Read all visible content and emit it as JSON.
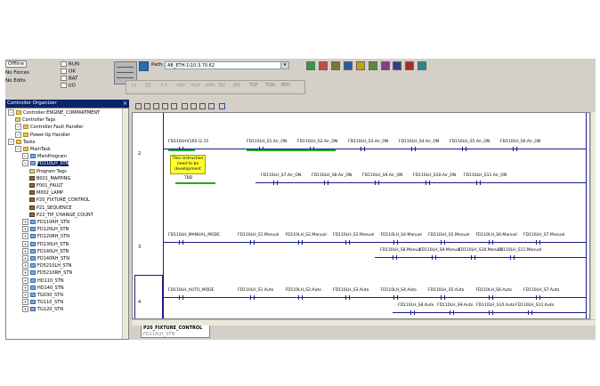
{
  "status": {
    "mode": "Offline",
    "forces": "No Forces",
    "edits": "No Edits",
    "flags": [
      "RUN",
      "OK",
      "BAT",
      "I/O"
    ]
  },
  "path": {
    "label": "Path:",
    "value": "AB_ETH-1\\10.3.70.62"
  },
  "instruction_toolbar": [
    "|-|",
    "|/|",
    "-( )-",
    "<|>",
    "<L>",
    "<U>",
    "(L)",
    "(U)",
    "TOF",
    "TON",
    "RTO"
  ],
  "organizer": {
    "title": "Controller Organizer",
    "items": [
      {
        "label": "Controller ENGINE_COMPARTMENT",
        "type": "folder",
        "level": 0
      },
      {
        "label": "Controller Tags",
        "type": "tags",
        "level": 1
      },
      {
        "label": "Controller Fault Handler",
        "type": "folder",
        "level": 1
      },
      {
        "label": "Power-Up Handler",
        "type": "folder",
        "level": 1
      },
      {
        "label": "Tasks",
        "type": "folder",
        "level": 0
      },
      {
        "label": "MainTask",
        "type": "folder",
        "level": 1
      },
      {
        "label": "MainProgram",
        "type": "prog",
        "level": 2
      },
      {
        "label": "FD110LH_STN",
        "type": "prog",
        "level": 2,
        "selected": true
      },
      {
        "label": "Program Tags",
        "type": "tags",
        "level": 3
      },
      {
        "label": "B001_MAPPING",
        "type": "rout",
        "level": 3
      },
      {
        "label": "F001_FAULT",
        "type": "rout",
        "level": 3
      },
      {
        "label": "M002_LAMP",
        "type": "rout",
        "level": 3
      },
      {
        "label": "P20_FIXTURE_CONTROL",
        "type": "rout",
        "level": 3
      },
      {
        "label": "P21_SEQUENCE",
        "type": "rout",
        "level": 3
      },
      {
        "label": "P22_TIP_CHANGE_COUNT",
        "type": "rout",
        "level": 3
      },
      {
        "label": "FD110RH_STN",
        "type": "prog",
        "level": 2
      },
      {
        "label": "FD120LH_STN",
        "type": "prog",
        "level": 2
      },
      {
        "label": "FD120RH_STN",
        "type": "prog",
        "level": 2
      },
      {
        "label": "FD130LH_STN",
        "type": "prog",
        "level": 2
      },
      {
        "label": "FD140LH_STN",
        "type": "prog",
        "level": 2
      },
      {
        "label": "FD140RH_STN",
        "type": "prog",
        "level": 2
      },
      {
        "label": "FD5210LH_STN",
        "type": "prog",
        "level": 2
      },
      {
        "label": "FD5210RH_STN",
        "type": "prog",
        "level": 2
      },
      {
        "label": "HD110_STN",
        "type": "prog",
        "level": 2
      },
      {
        "label": "HD140_STN",
        "type": "prog",
        "level": 2
      },
      {
        "label": "TG030_STN",
        "type": "prog",
        "level": 2
      },
      {
        "label": "TG110_STN",
        "type": "prog",
        "level": 2
      },
      {
        "label": "TG120_STN",
        "type": "prog",
        "level": 2
      }
    ]
  },
  "ladder": {
    "rungs": [
      {
        "number": "2",
        "input_tag": "FD110LHV1RS I2.15",
        "note": "This instruction need to be development",
        "note_tag": "TBD",
        "outputs_row1": [
          "FD110LH_S1.Air_ON",
          "FD110LH_S2.Air_ON",
          "FD110LH_S3.Air_ON",
          "FD110LH_S4.Air_ON",
          "FD110LH_S5.Air_ON",
          "FD110LH_S6.Air_ON"
        ],
        "outputs_row2": [
          "FD110LH_S7.Air_ON",
          "FD110LH_S8.Air_ON",
          "FD110LH_S9.Air_ON",
          "FD110LH_S10.Air_ON",
          "FD110LH_S11.Air_ON"
        ]
      },
      {
        "number": "3",
        "input_tag": "FD110LH_MANUAL_MODE",
        "outputs_row1": [
          "FD110LH_S1.Manual",
          "FD110LH_S2.Manual",
          "FD110LH_S3.Manual",
          "FD110LH_S4.Manual",
          "FD110LH_S5.Manual",
          "FD110LH_S6.Manual",
          "FD110LH_S7.Manual"
        ],
        "outputs_row2": [
          "FD110LH_S8.Manual",
          "FD110LH_S9.Manual",
          "FD110LH_S10.Manual",
          "FD110LH_S11.Manual"
        ]
      },
      {
        "number": "4",
        "input_tag": "FD110LH_AUTO_MODE",
        "outputs_row1": [
          "FD110LH_S1.Auto",
          "FD110LH_S2.Auto",
          "FD110LH_S3.Auto",
          "FD110LH_S4.Auto",
          "FD110LH_S5.Auto",
          "FD110LH_S6.Auto",
          "FD110LH_S7.Auto"
        ],
        "outputs_row2": [
          "FD110LH_S8.Auto",
          "FD110LH_S9.Auto",
          "FD110LH_S10.Auto",
          "FD110LH_S11.Auto"
        ]
      }
    ]
  },
  "routine_tab": {
    "label": "P20_FIXTURE_CONTROL",
    "sublabel": "FD110LH_STN"
  }
}
